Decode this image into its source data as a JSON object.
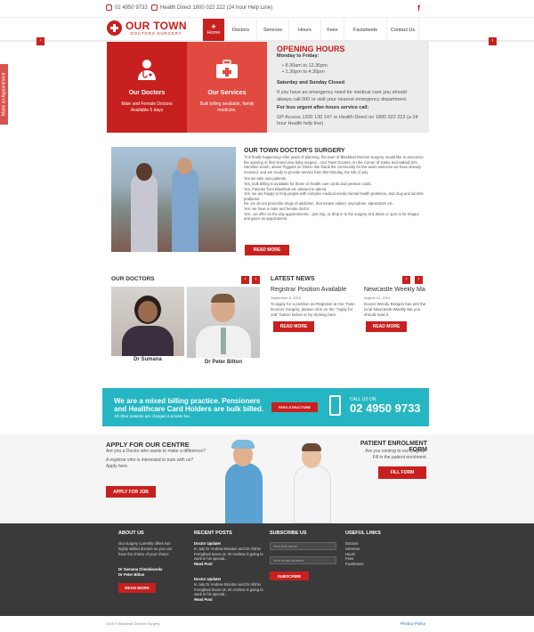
{
  "topbar": {
    "phone": "02 4950 9733",
    "health_direct": "Health Direct 1800 022 222 (24 hour Help Line)",
    "social": "f"
  },
  "logo": {
    "name": "OUR TOWN",
    "sub": "DOCTORS SURGERY"
  },
  "nav": {
    "items": [
      "Home",
      "Doctors",
      "Services",
      "Hours",
      "Fees",
      "Factsheets",
      "Contact Us"
    ]
  },
  "side_tab": "Make an Appointment",
  "boxes": [
    {
      "title": "Our Doctors",
      "text": "Male and Female Doctors Available 5 days"
    },
    {
      "title": "Our Services",
      "text": "Bulk billing available, family medicine."
    }
  ],
  "hours": {
    "title": "OPENING HOURS",
    "weekdays": "Monday to Friday:",
    "slot1": "8.30am to 12.30pm",
    "slot2": "1.30pm to 4.30pm",
    "weekend": "Saturday and Sunday Closed",
    "emergency": "If you have an emergency need for medical care you should always call 000 or visit your nearest emergency department.",
    "afterhours_label": "For less urgent after-hours service call:",
    "afterhours": "GP Access 1300 130 147 or Health Direct on 1800 022 222 (a 24 hour Health help line)"
  },
  "surgery": {
    "title": "OUR TOWN DOCTOR'S SURGERY",
    "p1": "\"It is finally happening! After years of planning, the town of Blackbutt Doctors Surgery, would like to announce the opening of their brand new baby surgery....Our Town Doctors, on the Corner of Glebe and Halsall St's, Hamilton South, above Piggotts on Glebe. We thank the community for the warm welcome we have already received, and are ready to provide service form this Monday, the 5th of July.",
    "p2": "Yes we take new patients.",
    "p3": "Yes, bulk billing is available for those on health care cards and pension cards.",
    "p4": "Yes, Patients from Blackbutt are allowed to attend.",
    "p5": "Yes, we are happy to help people with complex medical needs,mental health problems, and drug and alcohol problems.",
    "p6": "No, we do not prescribe drugs of addiction, that means valium, oxycodone, alprazolam etc..",
    "p7": "Yes, we have a male and female doctor.",
    "p8": "Yes...we offer on the day appointments....just ring, or drop in to the surgery at 8.30am or 1pm to be triaged and given an appointment.",
    "btn": "READ MORE"
  },
  "doctors": {
    "title": "OUR DOCTORS",
    "d1": "Dr Sumana",
    "d2": "Dr Peter Bilton"
  },
  "news": {
    "title": "LATEST NEWS",
    "n1_title": "Registrar Position Available",
    "n1_date": "September 8, 2015",
    "n1_text": "To apply for a position as Registrar at Our Town Doctors Surgery, please click on the \"Apply for Job\" button below or by clicking here.",
    "n2_title": "Newcastle Weekly Ma",
    "n2_date": "August 13, 2015",
    "n2_text": "Doctor Wendy Bridges has writ the local Newcastle Weekly Ma you should read it.",
    "btn": "READ MORE"
  },
  "band": {
    "headline": "We are a mixed billing practice. Pensioners and Healthcare Card Holders are bulk billed.",
    "sub": "All other patients are charged a private fee.",
    "btn": "FEES STRUCTURE",
    "callus": "CALL US ON",
    "phone": "02 4950 9733"
  },
  "apply": {
    "title": "APPLY FOR OUR CENTRE",
    "l1": "Are you a Doctor who wants to make a difference?",
    "l2": "A registrar who is interested to train with us?",
    "l3": "Apply here.",
    "btn": "APPLY FOR JOB"
  },
  "enrol": {
    "title": "PATIENT ENROLMENT FORM",
    "l1": "Are you coming to our surgery?",
    "l2": "Fill in the patient enrolment.",
    "btn": "FILL FORM"
  },
  "footer": {
    "about_h": "ABOUT US",
    "about_t": "Our surgery currently offers two highly skilled doctors so you can have the choice of your choice",
    "about_d1": "Dr Sumana Chedalavoda",
    "about_d2": "Dr Peter Bilton",
    "about_btn": "READ MORE",
    "recent_h": "RECENT POSTS",
    "post_title": "Doctor Update!",
    "post_text": "In July Dr Andrew Brunton and Dr Afshin Foroghani leave us. Dr Andrew is going to work in his special...",
    "post_link": "Read Post",
    "sub_h": "SUBSCRIBE US",
    "sub_name": "Your first name",
    "sub_email": "Your email address",
    "sub_btn": "SUBSCRIBE",
    "links_h": "USEFUL LINKS",
    "links": [
      "Doctors",
      "Services",
      "Hours",
      "Fees",
      "Factsheets"
    ]
  },
  "copyright": {
    "left": "2015 © Blackbutt Doctors Surgery",
    "right": "Privacy Policy"
  },
  "colors": {
    "accent": "#c8201e",
    "teal": "#26b6c3",
    "footer": "#3a3a3b"
  }
}
